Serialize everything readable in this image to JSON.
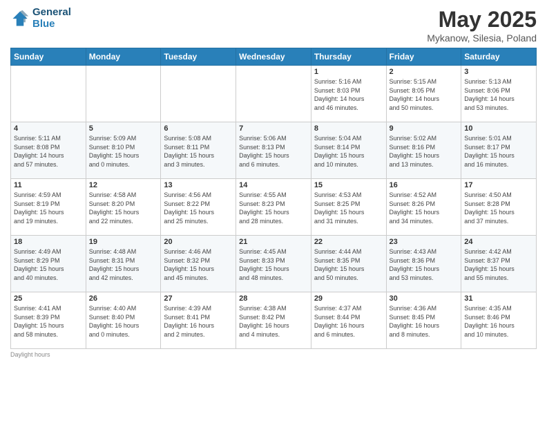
{
  "header": {
    "logo_line1": "General",
    "logo_line2": "Blue",
    "month_year": "May 2025",
    "location": "Mykanow, Silesia, Poland"
  },
  "days_of_week": [
    "Sunday",
    "Monday",
    "Tuesday",
    "Wednesday",
    "Thursday",
    "Friday",
    "Saturday"
  ],
  "weeks": [
    [
      {
        "day": "",
        "detail": ""
      },
      {
        "day": "",
        "detail": ""
      },
      {
        "day": "",
        "detail": ""
      },
      {
        "day": "",
        "detail": ""
      },
      {
        "day": "1",
        "detail": "Sunrise: 5:16 AM\nSunset: 8:03 PM\nDaylight: 14 hours\nand 46 minutes."
      },
      {
        "day": "2",
        "detail": "Sunrise: 5:15 AM\nSunset: 8:05 PM\nDaylight: 14 hours\nand 50 minutes."
      },
      {
        "day": "3",
        "detail": "Sunrise: 5:13 AM\nSunset: 8:06 PM\nDaylight: 14 hours\nand 53 minutes."
      }
    ],
    [
      {
        "day": "4",
        "detail": "Sunrise: 5:11 AM\nSunset: 8:08 PM\nDaylight: 14 hours\nand 57 minutes."
      },
      {
        "day": "5",
        "detail": "Sunrise: 5:09 AM\nSunset: 8:10 PM\nDaylight: 15 hours\nand 0 minutes."
      },
      {
        "day": "6",
        "detail": "Sunrise: 5:08 AM\nSunset: 8:11 PM\nDaylight: 15 hours\nand 3 minutes."
      },
      {
        "day": "7",
        "detail": "Sunrise: 5:06 AM\nSunset: 8:13 PM\nDaylight: 15 hours\nand 6 minutes."
      },
      {
        "day": "8",
        "detail": "Sunrise: 5:04 AM\nSunset: 8:14 PM\nDaylight: 15 hours\nand 10 minutes."
      },
      {
        "day": "9",
        "detail": "Sunrise: 5:02 AM\nSunset: 8:16 PM\nDaylight: 15 hours\nand 13 minutes."
      },
      {
        "day": "10",
        "detail": "Sunrise: 5:01 AM\nSunset: 8:17 PM\nDaylight: 15 hours\nand 16 minutes."
      }
    ],
    [
      {
        "day": "11",
        "detail": "Sunrise: 4:59 AM\nSunset: 8:19 PM\nDaylight: 15 hours\nand 19 minutes."
      },
      {
        "day": "12",
        "detail": "Sunrise: 4:58 AM\nSunset: 8:20 PM\nDaylight: 15 hours\nand 22 minutes."
      },
      {
        "day": "13",
        "detail": "Sunrise: 4:56 AM\nSunset: 8:22 PM\nDaylight: 15 hours\nand 25 minutes."
      },
      {
        "day": "14",
        "detail": "Sunrise: 4:55 AM\nSunset: 8:23 PM\nDaylight: 15 hours\nand 28 minutes."
      },
      {
        "day": "15",
        "detail": "Sunrise: 4:53 AM\nSunset: 8:25 PM\nDaylight: 15 hours\nand 31 minutes."
      },
      {
        "day": "16",
        "detail": "Sunrise: 4:52 AM\nSunset: 8:26 PM\nDaylight: 15 hours\nand 34 minutes."
      },
      {
        "day": "17",
        "detail": "Sunrise: 4:50 AM\nSunset: 8:28 PM\nDaylight: 15 hours\nand 37 minutes."
      }
    ],
    [
      {
        "day": "18",
        "detail": "Sunrise: 4:49 AM\nSunset: 8:29 PM\nDaylight: 15 hours\nand 40 minutes."
      },
      {
        "day": "19",
        "detail": "Sunrise: 4:48 AM\nSunset: 8:31 PM\nDaylight: 15 hours\nand 42 minutes."
      },
      {
        "day": "20",
        "detail": "Sunrise: 4:46 AM\nSunset: 8:32 PM\nDaylight: 15 hours\nand 45 minutes."
      },
      {
        "day": "21",
        "detail": "Sunrise: 4:45 AM\nSunset: 8:33 PM\nDaylight: 15 hours\nand 48 minutes."
      },
      {
        "day": "22",
        "detail": "Sunrise: 4:44 AM\nSunset: 8:35 PM\nDaylight: 15 hours\nand 50 minutes."
      },
      {
        "day": "23",
        "detail": "Sunrise: 4:43 AM\nSunset: 8:36 PM\nDaylight: 15 hours\nand 53 minutes."
      },
      {
        "day": "24",
        "detail": "Sunrise: 4:42 AM\nSunset: 8:37 PM\nDaylight: 15 hours\nand 55 minutes."
      }
    ],
    [
      {
        "day": "25",
        "detail": "Sunrise: 4:41 AM\nSunset: 8:39 PM\nDaylight: 15 hours\nand 58 minutes."
      },
      {
        "day": "26",
        "detail": "Sunrise: 4:40 AM\nSunset: 8:40 PM\nDaylight: 16 hours\nand 0 minutes."
      },
      {
        "day": "27",
        "detail": "Sunrise: 4:39 AM\nSunset: 8:41 PM\nDaylight: 16 hours\nand 2 minutes."
      },
      {
        "day": "28",
        "detail": "Sunrise: 4:38 AM\nSunset: 8:42 PM\nDaylight: 16 hours\nand 4 minutes."
      },
      {
        "day": "29",
        "detail": "Sunrise: 4:37 AM\nSunset: 8:44 PM\nDaylight: 16 hours\nand 6 minutes."
      },
      {
        "day": "30",
        "detail": "Sunrise: 4:36 AM\nSunset: 8:45 PM\nDaylight: 16 hours\nand 8 minutes."
      },
      {
        "day": "31",
        "detail": "Sunrise: 4:35 AM\nSunset: 8:46 PM\nDaylight: 16 hours\nand 10 minutes."
      }
    ]
  ],
  "footer": {
    "daylight_label": "Daylight hours"
  }
}
